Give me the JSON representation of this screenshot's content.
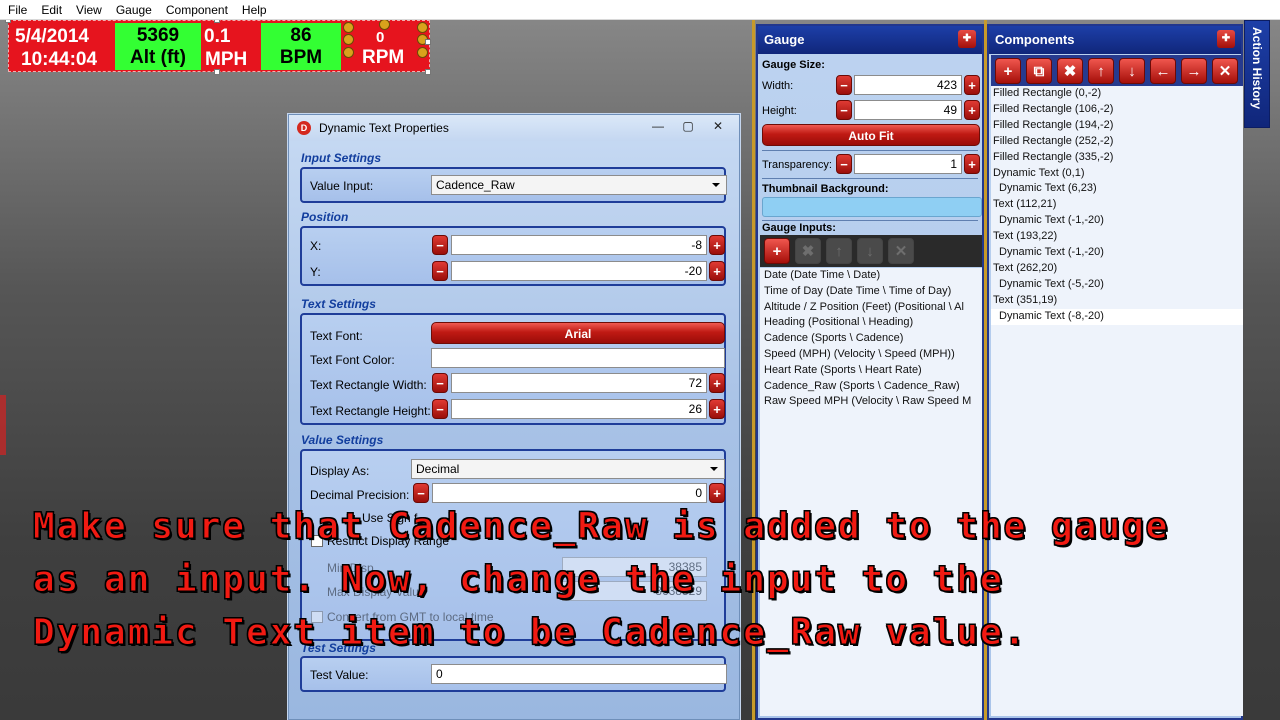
{
  "menu": [
    "File",
    "Edit",
    "View",
    "Gauge",
    "Component",
    "Help"
  ],
  "gauge_preview": {
    "date": "5/4/2014",
    "time": "10:44:04",
    "alt_value": "5369",
    "alt_label": "Alt (ft)",
    "speed_value": "0.1",
    "speed_unit": "MPH",
    "bpm_value": "86",
    "bpm_label": "BPM",
    "cadence_value": "0",
    "cadence_label": "RPM"
  },
  "dialog": {
    "title": "Dynamic Text Properties",
    "window_buttons": [
      "—",
      "▢",
      "✕"
    ],
    "input_settings": {
      "header": "Input Settings",
      "value_input_label": "Value Input:",
      "value_input": "Cadence_Raw"
    },
    "position": {
      "header": "Position",
      "x_label": "X:",
      "x": "-8",
      "y_label": "Y:",
      "y": "-20"
    },
    "text_settings": {
      "header": "Text Settings",
      "font_label": "Text Font:",
      "font_button": "Arial",
      "color_label": "Text Font Color:",
      "width_label": "Text Rectangle Width:",
      "width": "72",
      "height_label": "Text Rectangle Height:",
      "height": "26"
    },
    "value_settings": {
      "header": "Value Settings",
      "display_as_label": "Display As:",
      "display_as": "Decimal",
      "precision_label": "Decimal Precision:",
      "precision": "0",
      "sign_fragment": "Use Sign f",
      "restrict_label": "Restrict Display Range",
      "min_label": "Min Disp",
      "max_label": "Max Display Value",
      "min_val": "38385",
      "max_val": "3638529",
      "convert_label": "Convert from GMT to local time"
    },
    "test_settings": {
      "header": "Test Settings",
      "test_label": "Test Value:",
      "test_value": "0"
    }
  },
  "gauge_panel": {
    "title": "Gauge",
    "size_label": "Gauge Size:",
    "width_label": "Width:",
    "width": "423",
    "height_label": "Height:",
    "height": "49",
    "auto_fit": "Auto Fit",
    "transparency_label": "Transparency:",
    "transparency": "1",
    "thumb_bg_label": "Thumbnail Background:",
    "inputs_label": "Gauge Inputs:",
    "inputs": [
      "Date (Date Time \\ Date)",
      "Time of Day (Date Time \\ Time of Day)",
      "Altitude / Z Position (Feet) (Positional \\ Al",
      "Heading (Positional \\ Heading)",
      "Cadence (Sports \\ Cadence)",
      "Speed (MPH) (Velocity \\ Speed (MPH))",
      "Heart Rate (Sports \\ Heart Rate)",
      "Cadence_Raw (Sports \\ Cadence_Raw)",
      "Raw Speed MPH (Velocity \\ Raw Speed M"
    ]
  },
  "components_panel": {
    "title": "Components",
    "items": [
      {
        "label": "Filled Rectangle (0,-2)",
        "indent": false
      },
      {
        "label": "Filled Rectangle (106,-2)",
        "indent": false
      },
      {
        "label": "Filled Rectangle (194,-2)",
        "indent": false
      },
      {
        "label": "Filled Rectangle (252,-2)",
        "indent": false
      },
      {
        "label": "Filled Rectangle (335,-2)",
        "indent": false
      },
      {
        "label": "Dynamic Text (0,1)",
        "indent": false
      },
      {
        "label": "Dynamic Text (6,23)",
        "indent": true
      },
      {
        "label": "Text (112,21)",
        "indent": false
      },
      {
        "label": "Dynamic Text (-1,-20)",
        "indent": true
      },
      {
        "label": "Text (193,22)",
        "indent": false
      },
      {
        "label": "Dynamic Text (-1,-20)",
        "indent": true
      },
      {
        "label": "Text (262,20)",
        "indent": false
      },
      {
        "label": "Dynamic Text (-5,-20)",
        "indent": true
      },
      {
        "label": "Text (351,19)",
        "indent": false
      },
      {
        "label": "Dynamic Text (-8,-20)",
        "indent": true,
        "selected": true
      }
    ]
  },
  "action_history": "Action History",
  "overlay_text": "Make sure that Cadence_Raw is added to the gauge\nas an input. Now, change the input to the\nDynamic Text item to be Cadence_Raw value.",
  "colors": {
    "accent_red": "#c01a14",
    "panel_blue": "#1d3fa8",
    "gauge_red": "#e6141e",
    "gauge_green": "#33ff33"
  }
}
